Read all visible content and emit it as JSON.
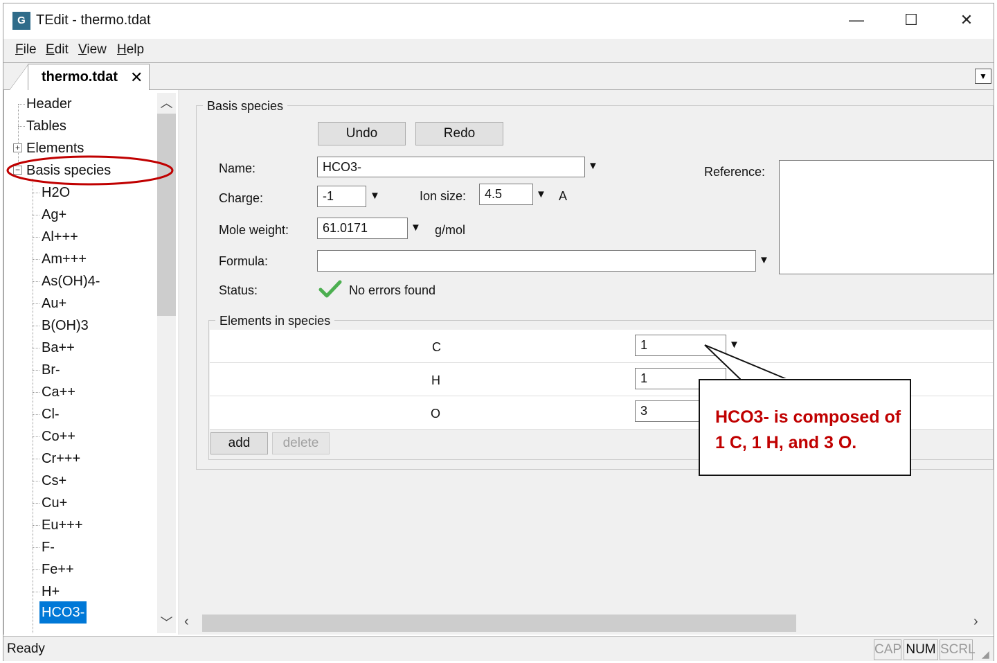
{
  "window": {
    "title": "TEdit - thermo.tdat",
    "icon_letter": "G"
  },
  "title_buttons": {
    "minimize": "—",
    "maximize": "☐",
    "close": "✕"
  },
  "menu": [
    "File",
    "Edit",
    "View",
    "Help"
  ],
  "tab": {
    "label": "thermo.tdat",
    "close": "✕"
  },
  "tree": {
    "top": [
      "Header",
      "Tables",
      "Elements",
      "Basis species"
    ],
    "species": [
      "H2O",
      "Ag+",
      "Al+++",
      "Am+++",
      "As(OH)4-",
      "Au+",
      "B(OH)3",
      "Ba++",
      "Br-",
      "Ca++",
      "Cl-",
      "Co++",
      "Cr+++",
      "Cs+",
      "Cu+",
      "Eu+++",
      "F-",
      "Fe++",
      "H+",
      "HCO3-"
    ],
    "selected": "HCO3-"
  },
  "form": {
    "group_title": "Basis species",
    "undo": "Undo",
    "redo": "Redo",
    "name_label": "Name:",
    "name_value": "HCO3-",
    "charge_label": "Charge:",
    "charge_value": "-1",
    "ion_size_label": "Ion size:",
    "ion_size_value": "4.5",
    "ion_size_unit": "A",
    "mole_weight_label": "Mole weight:",
    "mole_weight_value": "61.0171",
    "mole_weight_unit": "g/mol",
    "formula_label": "Formula:",
    "formula_value": "",
    "status_label": "Status:",
    "status_value": "No errors found",
    "reference_label": "Reference:",
    "reference_value": ""
  },
  "elements": {
    "group_title": "Elements in species",
    "rows": [
      {
        "name": "C",
        "count": "1"
      },
      {
        "name": "H",
        "count": "1"
      },
      {
        "name": "O",
        "count": "3"
      }
    ],
    "add": "add",
    "delete": "delete"
  },
  "status_bar": {
    "text": "Ready",
    "indicators": [
      "CAP",
      "NUM",
      "SCRL"
    ],
    "active": "NUM"
  },
  "annotation": {
    "text": "HCO3- is composed of 1 C, 1 H, and 3 O.",
    "color": "#c00000",
    "circle_color": "#c00000"
  },
  "colors": {
    "selection": "#0078d7",
    "check": "#4caf50"
  }
}
